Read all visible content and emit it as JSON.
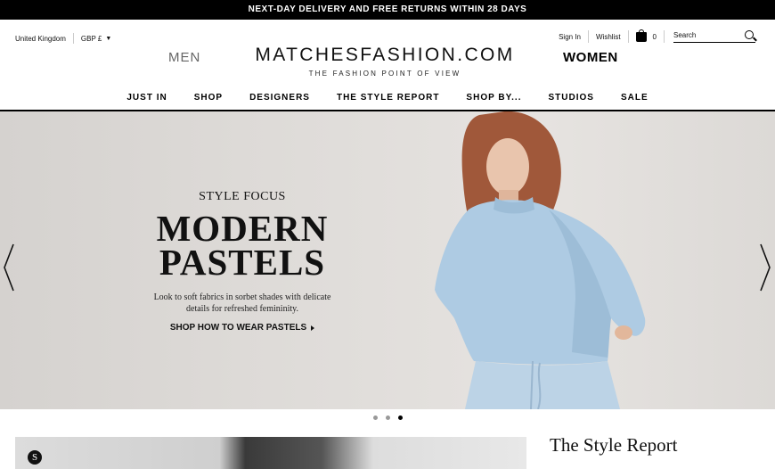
{
  "promo": {
    "text": "NEXT-DAY DELIVERY AND FREE RETURNS WITHIN 28 DAYS"
  },
  "locale": {
    "country": "United Kingdom",
    "currency": "GBP £"
  },
  "account": {
    "sign_in": "Sign In",
    "wishlist": "Wishlist",
    "bag_count": "0",
    "search_placeholder": "Search"
  },
  "header": {
    "men": "MEN",
    "logo": "MATCHESFASHION.COM",
    "tagline": "THE FASHION POINT OF VIEW",
    "women": "WOMEN"
  },
  "nav": [
    "JUST IN",
    "SHOP",
    "DESIGNERS",
    "THE STYLE REPORT",
    "SHOP BY...",
    "STUDIOS",
    "SALE"
  ],
  "hero": {
    "eyebrow": "STYLE FOCUS",
    "headline": "MODERN\nPASTELS",
    "description": "Look to soft fabrics in sorbet shades with delicate\ndetails for refreshed femininity.",
    "cta": "SHOP HOW TO WEAR PASTELS"
  },
  "carousel": {
    "total": 3,
    "active_index": 2
  },
  "style_report": {
    "title": "The Style Report",
    "badge": "S"
  },
  "colors": {
    "sweater": "#aecbe3",
    "promo_bg": "#000000",
    "hero_bg": "#dedbd8"
  }
}
